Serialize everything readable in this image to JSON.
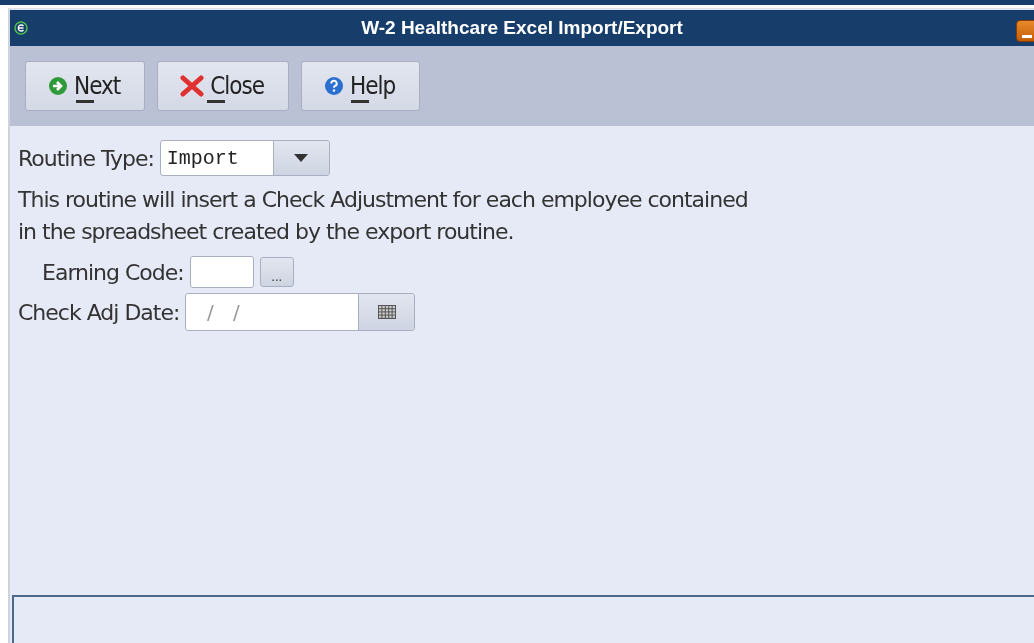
{
  "window": {
    "title": "W-2 Healthcare Excel Import/Export"
  },
  "toolbar": {
    "buttons": [
      {
        "kind": "next",
        "label": "Next"
      },
      {
        "kind": "close",
        "label": "Close"
      },
      {
        "kind": "help",
        "label": "Help"
      }
    ]
  },
  "routine_type": {
    "label": "Routine Type:",
    "value": "Import"
  },
  "description": "This routine will insert a Check Adjustment for each employee contained\nin the spreadsheet created by the export routine.",
  "earning_code": {
    "label": "Earning Code:",
    "lookup": "..."
  },
  "check_adj_date": {
    "label": "Check Adj Date:",
    "placeholder": "  /   /"
  }
}
